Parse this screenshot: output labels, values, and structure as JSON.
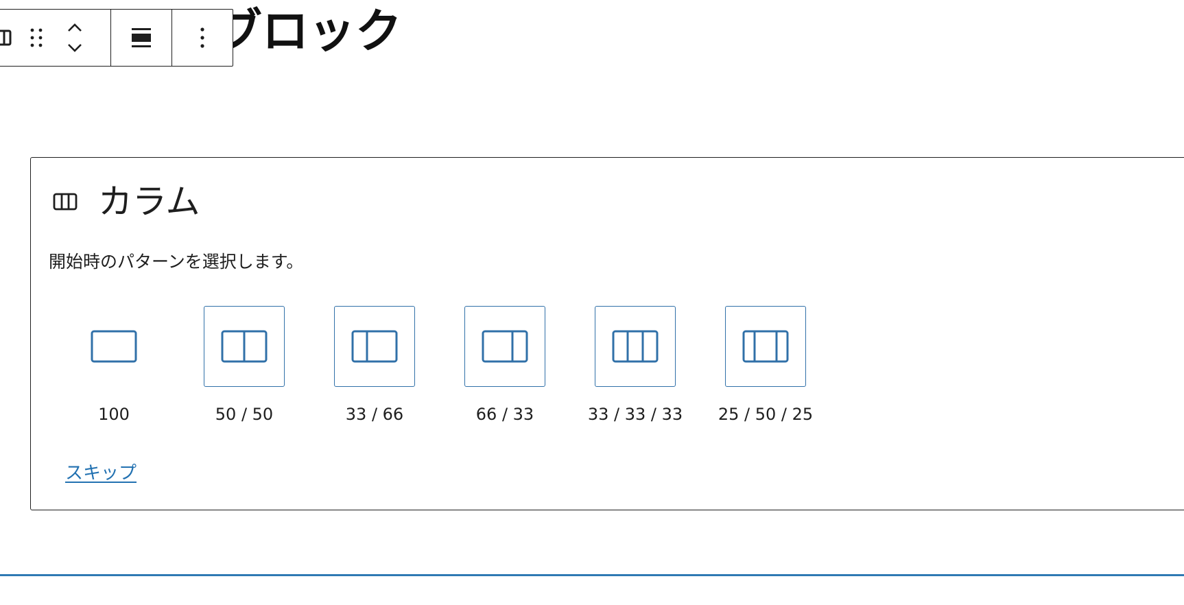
{
  "page": {
    "title_visible": "ムブロック"
  },
  "toolbar": {
    "items": [
      "parent-block-icon",
      "drag-handle-icon",
      "move-up-icon",
      "move-down-icon",
      "align-icon",
      "more-options-icon"
    ]
  },
  "placeholder": {
    "icon": "columns-icon",
    "label": "カラム",
    "instructions": "開始時のパターンを選択します。",
    "variations": [
      {
        "label": "100",
        "icon": "column-100-icon"
      },
      {
        "label": "50 / 50",
        "icon": "column-50-50-icon"
      },
      {
        "label": "33 / 66",
        "icon": "column-33-66-icon"
      },
      {
        "label": "66 / 33",
        "icon": "column-66-33-icon"
      },
      {
        "label": "33 / 33 / 33",
        "icon": "column-33-33-33-icon"
      },
      {
        "label": "25 / 50 / 25",
        "icon": "column-25-50-25-icon"
      }
    ],
    "skip_label": "スキップ"
  },
  "colors": {
    "accent": "#2271b1",
    "text": "#1e1e1e",
    "border": "#1e1e1e"
  }
}
